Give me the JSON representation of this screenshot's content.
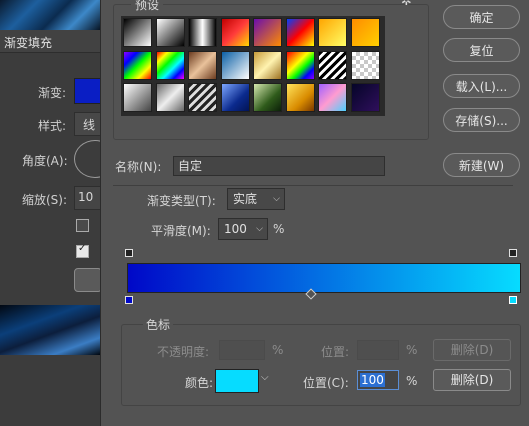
{
  "left_panel": {
    "title": "渐变填充",
    "labels": {
      "gradient": "渐变:",
      "style": "样式:",
      "style_value": "线",
      "angle": "角度(A):",
      "scale": "缩放(S):",
      "scale_value": "10"
    }
  },
  "presets": {
    "title": "预设",
    "swatches": [
      "linear-gradient(135deg,#000 0%,#fff 100%)",
      "linear-gradient(135deg,#fff 0%,#000 100%)",
      "linear-gradient(90deg,#000 0%,#fff 50%,#000 100%)",
      "linear-gradient(135deg,#c00000 0%,#ff3b3b 50%,#ffd700 100%)",
      "linear-gradient(135deg,#6a0dad 0%,#ff8c00 100%)",
      "linear-gradient(135deg,#0040ff 0%,#ff0000 50%,#ffff00 100%)",
      "linear-gradient(135deg,#ffa500 0%,#ffff66 100%)",
      "linear-gradient(135deg,#ff8c00 0%,#ffd000 100%)",
      "linear-gradient(135deg,#8b00ff,#0000ff,#00ff00,#ffff00,#ff0000)",
      "linear-gradient(135deg,#ff0000,#ffff00,#00ff00,#00ffff,#0000ff,#ff00ff)",
      "linear-gradient(135deg,#6b3b1f 0%,#e9c29b 50%,#6b3b1f 100%)",
      "linear-gradient(135deg,#0b5fa5 0%,#fff 100%)",
      "linear-gradient(135deg,#c79b3a 0%,#fff3b0 50%,#9c7020 100%)",
      "linear-gradient(135deg,#ff0000,#ff7f00,#ffff00,#00ff00,#0000ff,#8b00ff)",
      "repeating-linear-gradient(135deg,#000 0 3px,#fff 3px 6px)",
      "checker",
      "linear-gradient(135deg,#fff 0%,#444 100%)",
      "linear-gradient(135deg,#666 0%,#eee 50%,#666 100%)",
      "repeating-linear-gradient(135deg,#222 0 3px,#ddd 3px 6px)",
      "linear-gradient(135deg,#7da7ff 0%,#0b2a8e 60%,#021455 100%)",
      "linear-gradient(135deg,#d6e8b0 0%,#2f5b1b 60%,#0c2009 100%)",
      "linear-gradient(135deg,#ffe45c 0%,#d98c00 60%,#7a3800 100%)",
      "linear-gradient(135deg,#a05fff 0%,#ff9cd0 50%,#4bd1ff 100%)",
      "linear-gradient(135deg,#050528 0%,#2f0f5c 100%)"
    ]
  },
  "buttons": {
    "ok": "确定",
    "reset": "复位",
    "load": "载入(L)...",
    "save": "存储(S)...",
    "new": "新建(W)",
    "delete": "删除(D)",
    "delete_disabled": "删除(D)"
  },
  "name": {
    "label": "名称(N):",
    "value": "自定"
  },
  "gradient_type": {
    "label": "渐变类型(T):",
    "value": "实底"
  },
  "smoothness": {
    "label": "平滑度(M):",
    "value": "100",
    "unit": "%"
  },
  "gradient_bar": {
    "color_start": "#0008c8",
    "color_end": "#06dcff",
    "midpoint_percent": 50
  },
  "color_stops": {
    "title": "色标",
    "opacity_label": "不透明度:",
    "opacity_unit": "%",
    "opacity_location_label": "位置:",
    "opacity_location_unit": "%",
    "color_label": "颜色:",
    "color_value": "#06dcff",
    "location_label": "位置(C):",
    "location_value": "100",
    "location_unit": "%"
  },
  "icons": {
    "settings": "gear-icon",
    "caret": "chevron-down-icon"
  }
}
